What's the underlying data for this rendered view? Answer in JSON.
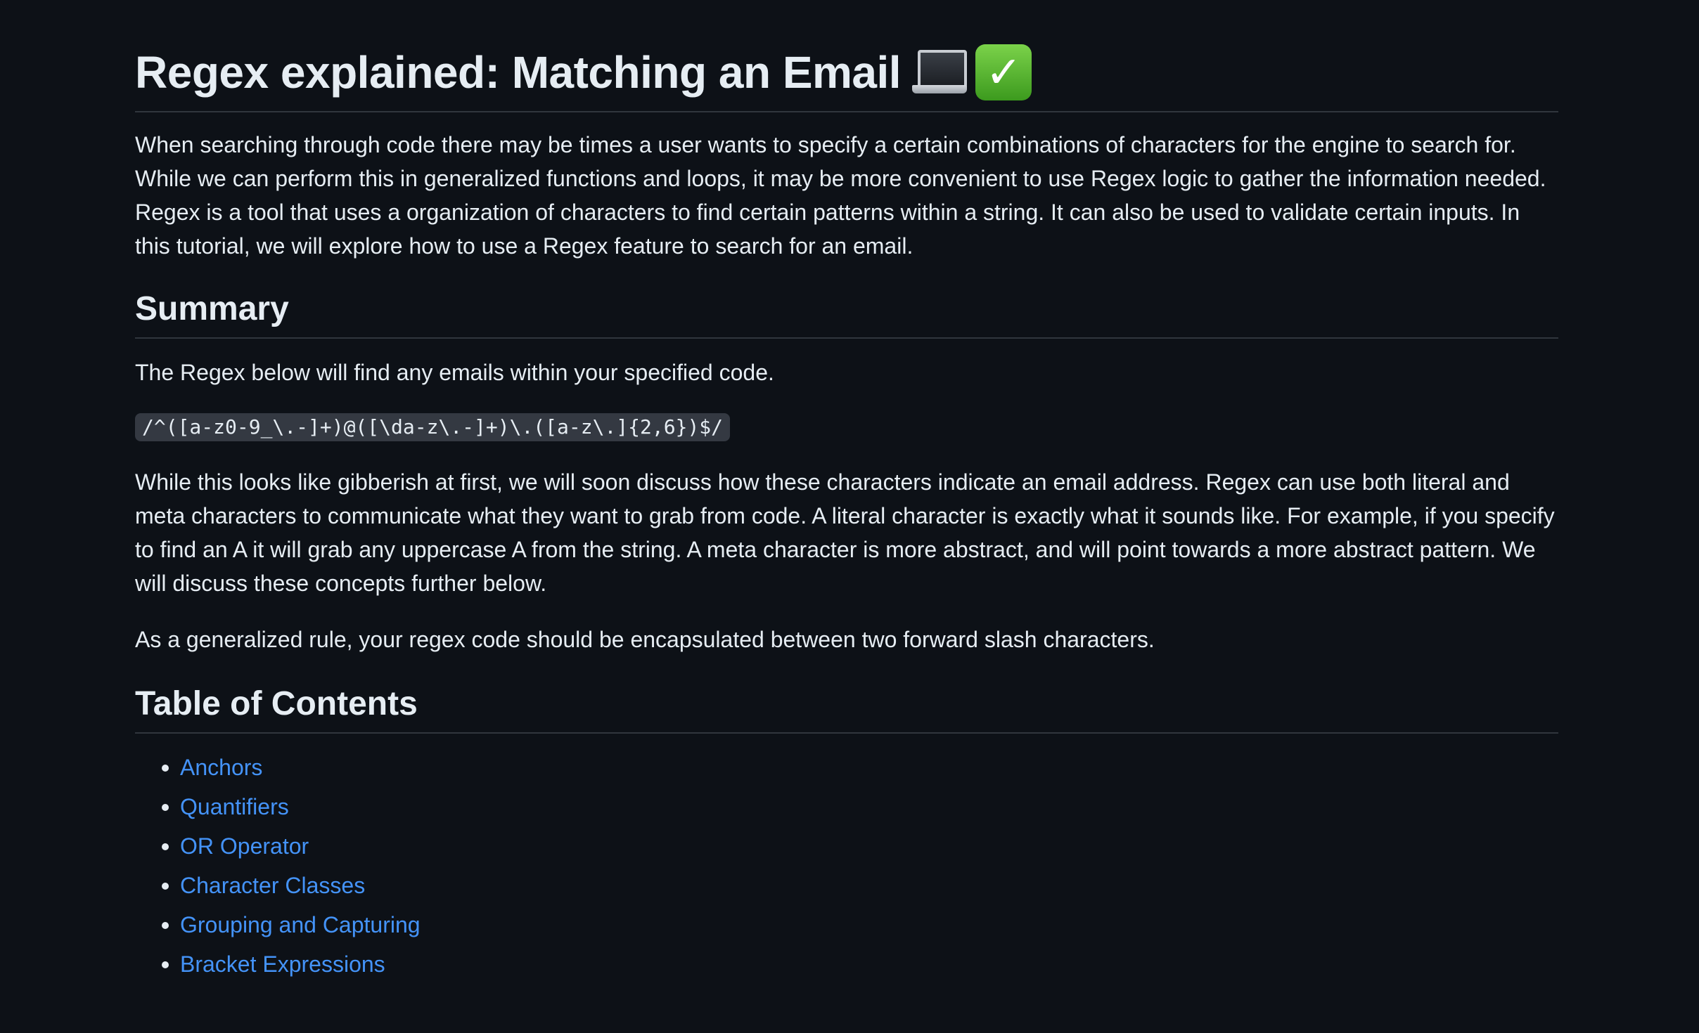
{
  "article": {
    "title": "Regex explained: Matching an Email",
    "title_emojis": [
      "laptop-icon",
      "check-mark-icon"
    ],
    "intro": "When searching through code there may be times a user wants to specify a certain combinations of characters for the engine to search for. While we can perform this in generalized functions and loops, it may be more convenient to use Regex logic to gather the information needed. Regex is a tool that uses a organization of characters to find certain patterns within a string. It can also be used to validate certain inputs. In this tutorial, we will explore how to use a Regex feature to search for an email.",
    "summary_heading": "Summary",
    "summary_text": "The Regex below will find any emails within your specified code.",
    "regex_code": "/^([a-z0-9_\\.-]+)@([\\da-z\\.-]+)\\.([a-z\\.]{2,6})$/",
    "gibberish_text": "While this looks like gibberish at first, we will soon discuss how these characters indicate an email address. Regex can use both literal and meta characters to communicate what they want to grab from code. A literal character is exactly what it sounds like. For example, if you specify to find an A it will grab any uppercase A from the string. A meta character is more abstract, and will point towards a more abstract pattern. We will discuss these concepts further below.",
    "rule_text": "As a generalized rule, your regex code should be encapsulated between two forward slash characters.",
    "toc_heading": "Table of Contents",
    "toc_items": [
      {
        "label": "Anchors"
      },
      {
        "label": "Quantifiers"
      },
      {
        "label": "OR Operator"
      },
      {
        "label": "Character Classes"
      },
      {
        "label": "Grouping and Capturing"
      },
      {
        "label": "Bracket Expressions"
      }
    ]
  },
  "colors": {
    "background": "#0d1117",
    "text": "#e6edf3",
    "link": "#4493f8",
    "divider": "#30363d",
    "code_background": "#343942"
  }
}
